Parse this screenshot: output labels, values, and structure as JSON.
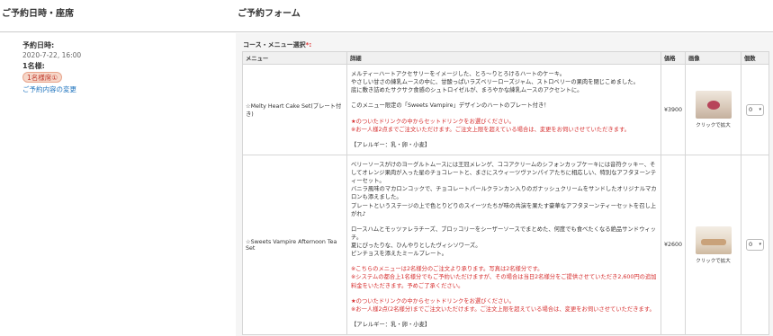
{
  "left_header": {
    "title": "ご予約日時・座席"
  },
  "right_header": {
    "title": "ご予約フォーム"
  },
  "sidebar": {
    "label": "予約日時:",
    "datetime": "2020-7-22, 16:00",
    "count": "1名様:",
    "seat_badge": "1名様席①",
    "change_link": "ご予約内容の変更"
  },
  "form": {
    "section_label": "コース・メニュー選択",
    "required_mark": "*:",
    "columns": {
      "menu": "メニュー",
      "detail": "詳細",
      "price": "価格",
      "image": "画像",
      "qty": "個数"
    },
    "items": [
      {
        "name": "☆Melty Heart Cake Set(プレート付き)",
        "detail": {
          "l1": "メルティーハートアクセサリーをイメージした、とろ〜りとろけるハートのケーキ。",
          "l2": "やさしい甘さの練乳ムースの中に、甘酸っぱいラズベリーローズジャム、ストロベリーの果肉を閉じこめました。",
          "l3": "底に敷き詰めたサクサク食感のシュトロイゼルが、まろやかな練乳ムースのアクセントに。",
          "l4": "このメニュー限定の「Sweets Vampire」デザインのハートのプレート付き！",
          "r1": "★のついたドリンクの中からセットドリンクをお選びください。",
          "r2": "※お一人様2点までご注文いただけます。ご注文上限を超えている場合は、変更をお伺いさせていただきます。",
          "allergy": "【アレルギー：乳・卵・小麦】"
        },
        "price": "¥3900",
        "image_caption": "クリックで拡大",
        "qty": "0"
      },
      {
        "name": "☆Sweets Vampire Afternoon Tea Set",
        "detail": {
          "l1": "ベリーソースがけのヨーグルトムースには王冠メレンゲ、ココアクリームのシフォンカップケーキには音符クッキー、そしてオレンジ果肉が入った星のチョコレートと、まさにスウィーツヴァンパイアたちに相応しい、特別なアフタヌーンティーセット。",
          "l2": "バニラ風味のマカロンコックで、チョコレートパールクランカン入りのガナッシュクリームをサンドしたオリジナルマカロンも添えました。",
          "l3": "プレートというステージの上で色とりどりのスイーツたちが味の共演を果たす豪華なアフタヌーンティーセットを召し上がれ♪",
          "l4": "ロースハムとモッツァレラチーズ、ブロッコリーをシーザーソースでまとめた、何度でも食べたくなる絶品サンドウィッチ。",
          "l5": "夏にぴったりな、ひんやりとしたヴィシソワーズ。",
          "l6": "ピンチョスを添えたミールプレート。",
          "r1": "※こちらのメニューは2名様分のご注文より承ります。写真は2名様分です。",
          "r2": "※システムの都合上1名様分でもご予約いただけますが、その場合は当日2名様分をご提供させていただき2,600円の追加料金をいただきます。予めご了承ください。",
          "r3": "★のついたドリンクの中からセットドリンクをお選びください。",
          "r4": "※お一人様2点(2名様分)までご注文いただけます。ご注文上限を超えている場合は、変更をお伺いさせていただきます。",
          "allergy": "【アレルギー：乳・卵・小麦】"
        },
        "price": "¥2600",
        "image_caption": "クリックで拡大",
        "qty": "0"
      }
    ]
  },
  "colors": {
    "accent_link": "#1e73be",
    "warning_red": "#d62d2d",
    "badge_bg": "#f6d7c9"
  }
}
